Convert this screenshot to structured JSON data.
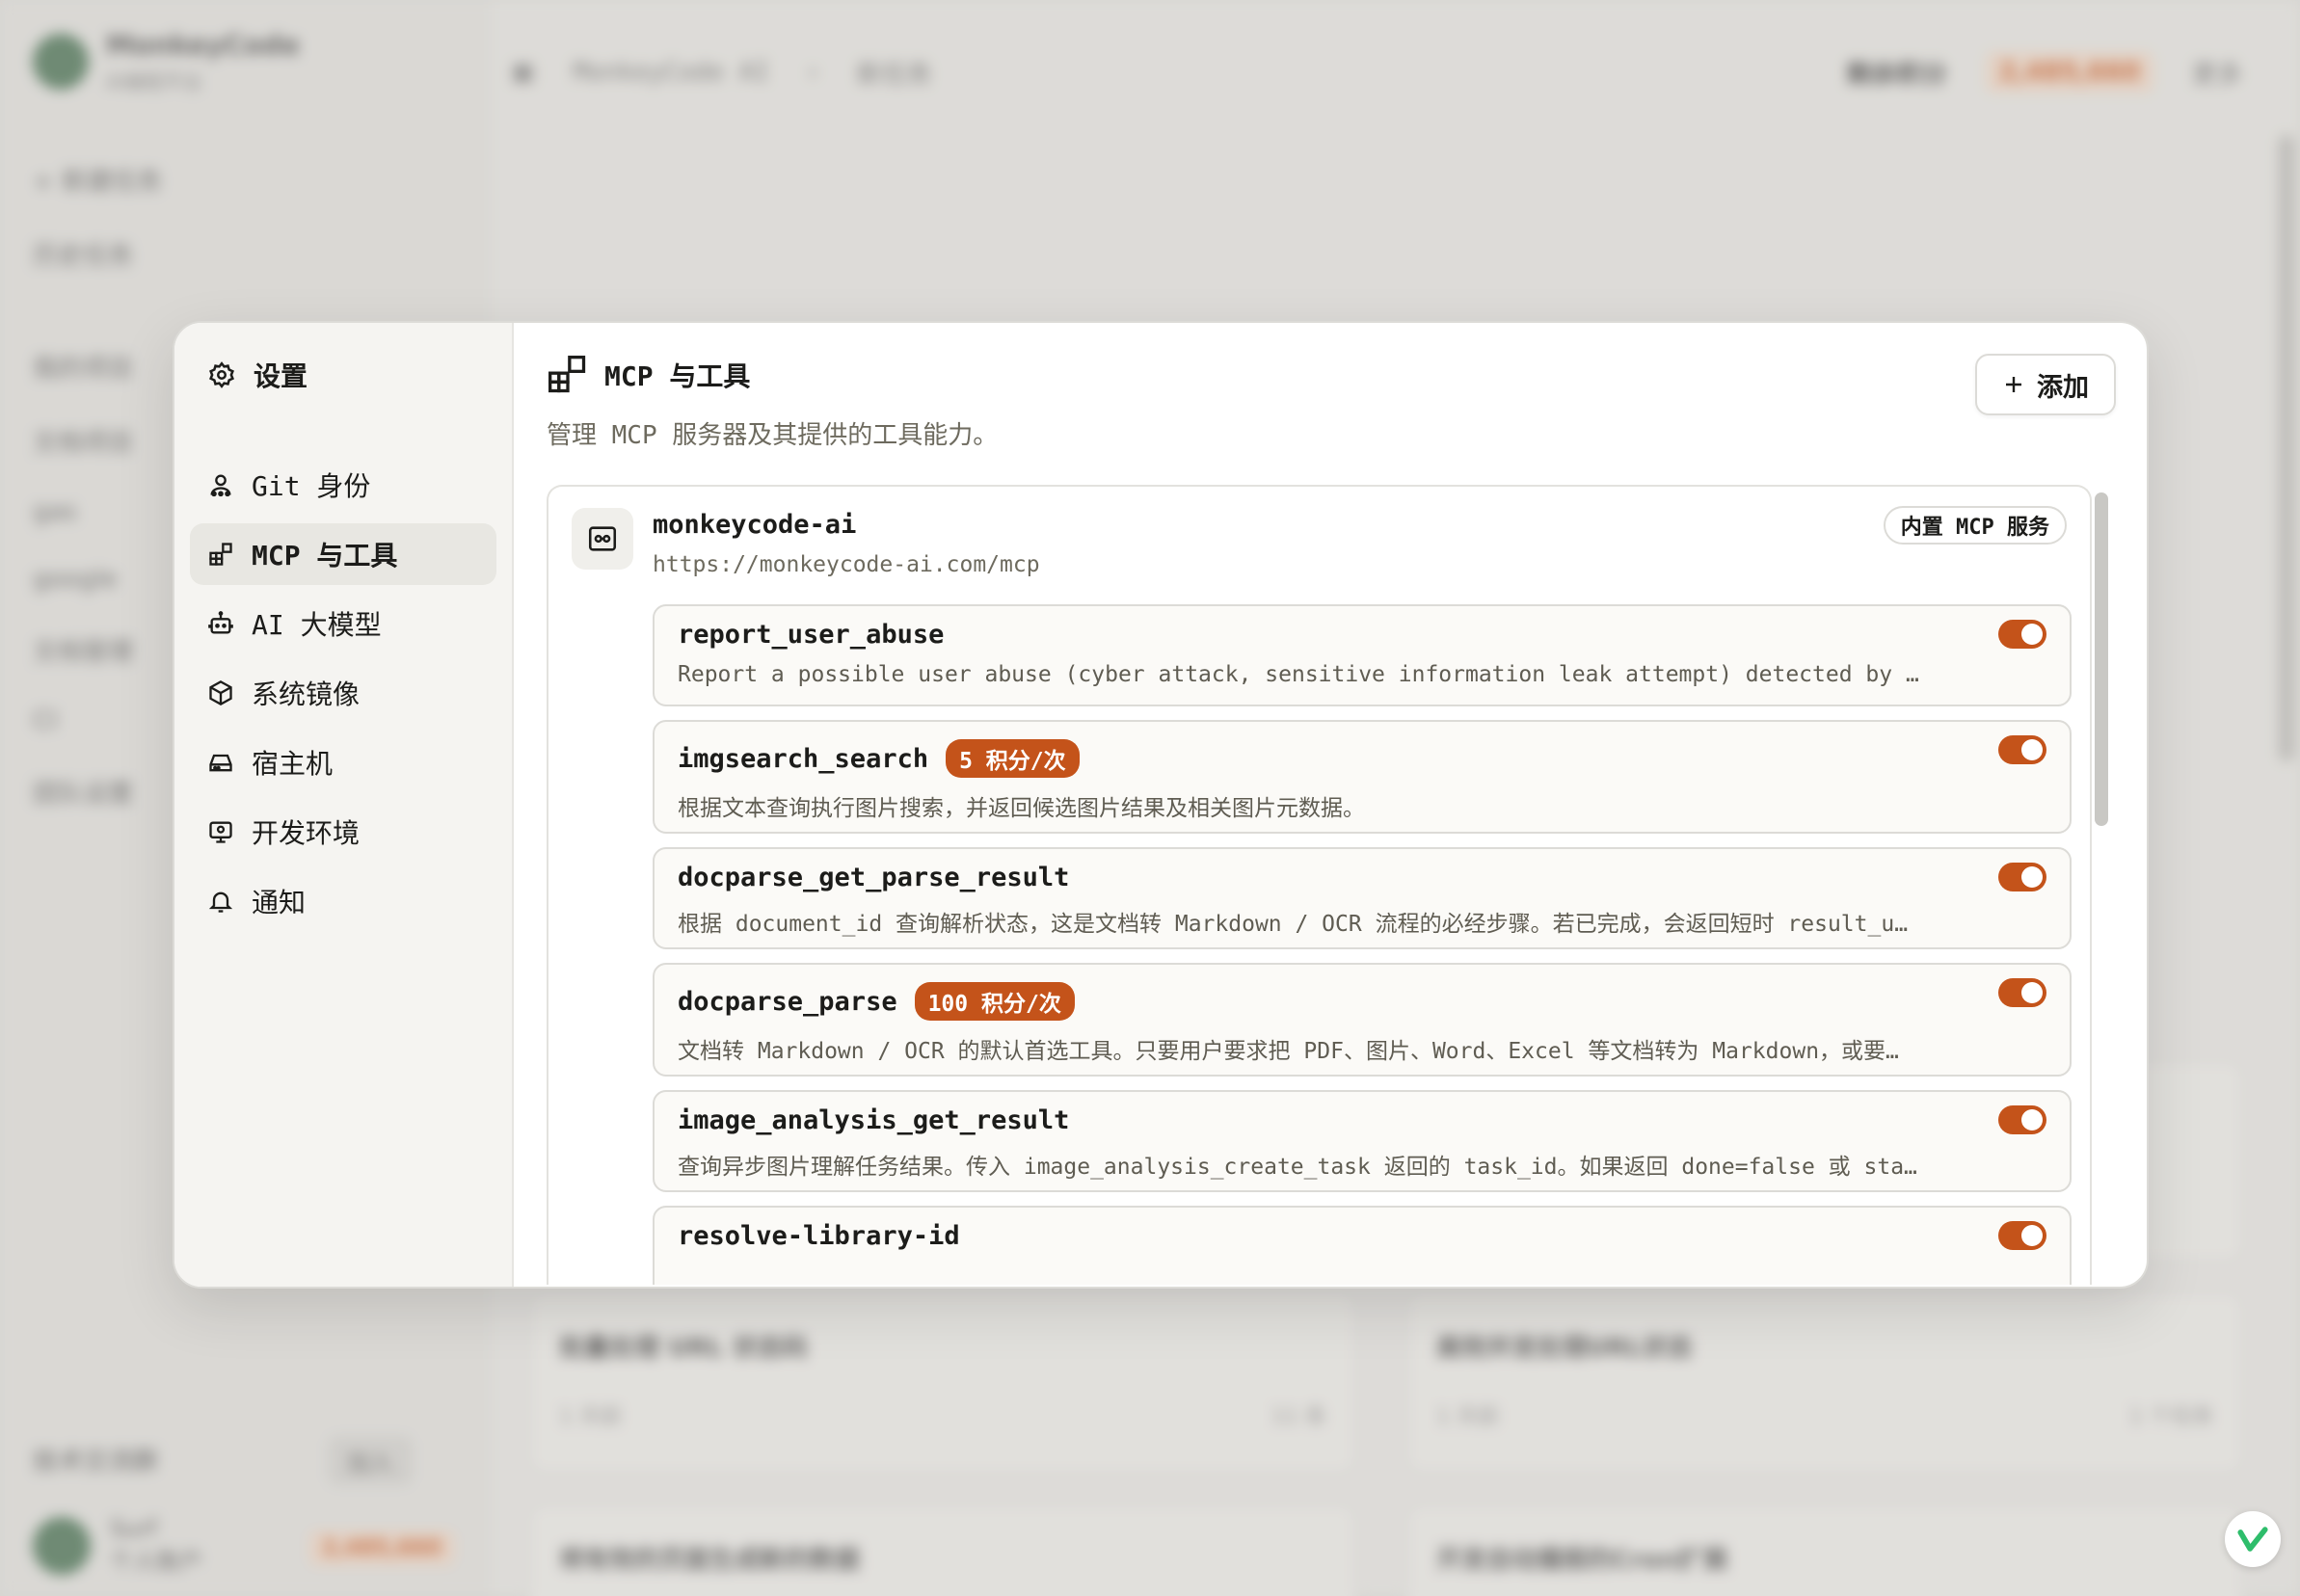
{
  "background": {
    "brand_name": "MonkeyCode",
    "brand_sub": "AI编程平台",
    "nav": [
      "+ 新建任务",
      "历史任务"
    ],
    "nav2": [
      "我的项目",
      "文档项目",
      "gas",
      "google",
      "文档管理",
      "CI",
      "团队设置"
    ],
    "header_breadcrumb": [
      "MonkeyCode AI",
      "新任务"
    ],
    "header_credit_label": "剩余积分",
    "header_credit_value": "2,485,660",
    "header_right": "更多",
    "team_label": "技术交流群",
    "team_button": "加入",
    "user_name": "Surf",
    "user_sub": "个人账户",
    "user_credit": "2,485,660",
    "cards": [
      {
        "title": "",
        "meta_left": "",
        "meta_right": ""
      },
      {
        "title": "",
        "meta_left": "",
        "meta_right": ""
      },
      {
        "title": "批量处理 URL 状态码",
        "meta_left": "1 天前",
        "meta_right": "11 条"
      },
      {
        "title": "高效并发处理URL状态",
        "meta_left": "1 天前",
        "meta_right": "1 个任务"
      },
      {
        "title": "将有效的页面生成新的数据",
        "meta_left": "",
        "meta_right": ""
      },
      {
        "title": "开发自动播报的Cron扩展",
        "meta_left": "",
        "meta_right": ""
      }
    ]
  },
  "modal": {
    "sidebar": {
      "title": "设置",
      "items": [
        {
          "label": "Git 身份",
          "icon": "git-identity-icon"
        },
        {
          "label": "MCP 与工具",
          "icon": "mcp-icon",
          "active": true
        },
        {
          "label": "AI 大模型",
          "icon": "robot-icon"
        },
        {
          "label": "系统镜像",
          "icon": "cube-icon"
        },
        {
          "label": "宿主机",
          "icon": "server-icon"
        },
        {
          "label": "开发环境",
          "icon": "monitor-icon"
        },
        {
          "label": "通知",
          "icon": "bell-icon"
        }
      ]
    },
    "title": "MCP 与工具",
    "subtitle": "管理 MCP 服务器及其提供的工具能力。",
    "add_label": "添加",
    "server": {
      "name": "monkeycode-ai",
      "url": "https://monkeycode-ai.com/mcp",
      "badge": "内置 MCP 服务",
      "tools": [
        {
          "name": "report_user_abuse",
          "credit": "",
          "desc": "Report a possible user abuse (cyber attack, sensitive information leak attempt) detected by …",
          "enabled": true
        },
        {
          "name": "imgsearch_search",
          "credit": "5 积分/次",
          "desc": "根据文本查询执行图片搜索，并返回候选图片结果及相关图片元数据。",
          "enabled": true
        },
        {
          "name": "docparse_get_parse_result",
          "credit": "",
          "desc": "根据 document_id 查询解析状态，这是文档转 Markdown / OCR 流程的必经步骤。若已完成，会返回短时 result_u…",
          "enabled": true
        },
        {
          "name": "docparse_parse",
          "credit": "100 积分/次",
          "desc": "文档转 Markdown / OCR 的默认首选工具。只要用户要求把 PDF、图片、Word、Excel 等文档转为 Markdown，或要…",
          "enabled": true
        },
        {
          "name": "image_analysis_get_result",
          "credit": "",
          "desc": "查询异步图片理解任务结果。传入 image_analysis_create_task 返回的 task_id。如果返回 done=false 或 sta…",
          "enabled": true
        },
        {
          "name": "resolve-library-id",
          "credit": "",
          "desc": "",
          "enabled": true
        }
      ]
    }
  },
  "colors": {
    "accent": "#c4531a",
    "modal_bg": "#ffffff",
    "sidebar_bg": "#f5f4f1"
  }
}
